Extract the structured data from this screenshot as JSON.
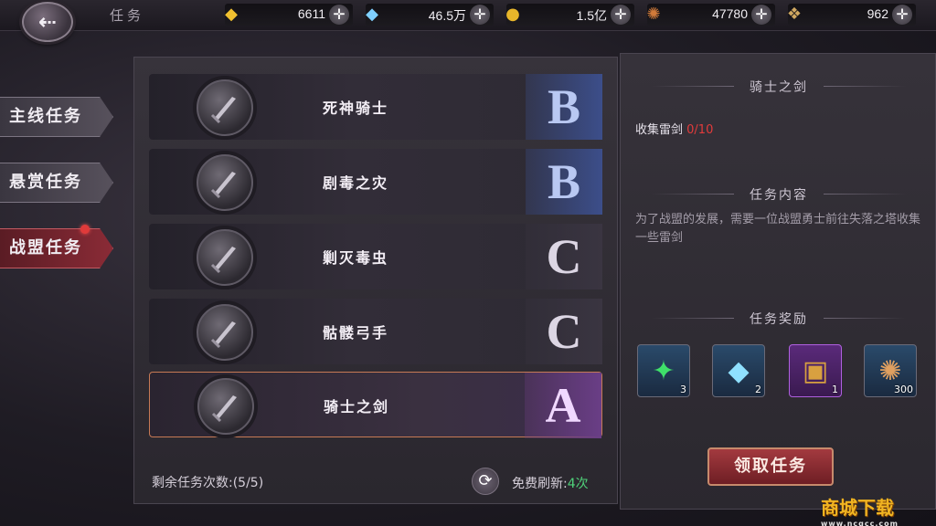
{
  "header": {
    "title": "任务",
    "resources": [
      {
        "icon": "gold-bar-icon",
        "value": "6611",
        "color": "#f0c030"
      },
      {
        "icon": "diamond-icon",
        "value": "46.5万",
        "color": "#7fd0ff"
      },
      {
        "icon": "coin-icon",
        "value": "1.5亿",
        "color": "#e8b62a"
      },
      {
        "icon": "medal-icon",
        "value": "47780",
        "color": "#d07a3a"
      },
      {
        "icon": "scroll-icon",
        "value": "962",
        "color": "#d0a860"
      }
    ]
  },
  "sidebar": {
    "tabs": [
      {
        "label": "主线任务",
        "active": false
      },
      {
        "label": "悬赏任务",
        "active": false
      },
      {
        "label": "战盟任务",
        "active": true,
        "badge": true
      }
    ]
  },
  "tasks": [
    {
      "name": "死神骑士",
      "grade": "B"
    },
    {
      "name": "剧毒之灾",
      "grade": "B"
    },
    {
      "name": "剿灭毒虫",
      "grade": "C"
    },
    {
      "name": "骷髅弓手",
      "grade": "C"
    },
    {
      "name": "骑士之剑",
      "grade": "A",
      "selected": true
    }
  ],
  "footer": {
    "remaining_label": "剩余任务次数:(5/5)",
    "free_refresh_label": "免费刷新:",
    "free_refresh_count": "4次"
  },
  "detail": {
    "title": "骑士之剑",
    "objective_label": "收集雷剑",
    "objective_progress": "0/10",
    "content_title": "任务内容",
    "content_text": "为了战盟的发展，需要一位战盟勇士前往失落之塔收集一些雷剑",
    "reward_title": "任务奖励",
    "rewards": [
      {
        "icon": "green-gem-icon",
        "qty": "3"
      },
      {
        "icon": "blue-crystal-icon",
        "qty": "2"
      },
      {
        "icon": "book-icon",
        "qty": "1"
      },
      {
        "icon": "bronze-medal-icon",
        "qty": "300"
      }
    ],
    "accept_label": "领取任务"
  },
  "watermark": {
    "main": "商城下载",
    "sub": "www.ncgcc.com"
  }
}
